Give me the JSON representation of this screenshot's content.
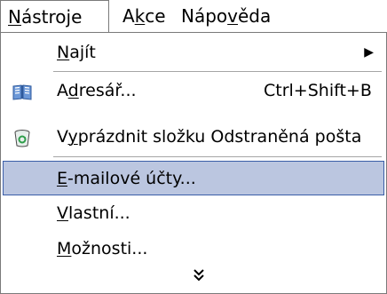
{
  "menubar": {
    "items": [
      {
        "pre": "",
        "hot": "N",
        "post": "ástroje"
      },
      {
        "pre": "A",
        "hot": "k",
        "post": "ce"
      },
      {
        "pre": "Nápo",
        "hot": "v",
        "post": "ěda"
      }
    ]
  },
  "menu": {
    "items": [
      {
        "pre": "",
        "hot": "N",
        "post": "ajít",
        "shortcut": "",
        "icon": "",
        "submenu": true
      },
      {
        "pre": "A",
        "hot": "d",
        "post": "resář...",
        "shortcut": "Ctrl+Shift+B",
        "icon": "address-book-icon",
        "submenu": false
      },
      {
        "pre": "V",
        "hot": "y",
        "post": "prázdnit složku Odstraněná pošta",
        "shortcut": "",
        "icon": "recycle-bin-icon",
        "submenu": false
      },
      {
        "pre": "",
        "hot": "E",
        "post": "-mailové účty...",
        "shortcut": "",
        "icon": "",
        "submenu": false
      },
      {
        "pre": "",
        "hot": "V",
        "post": "lastní...",
        "shortcut": "",
        "icon": "",
        "submenu": false
      },
      {
        "pre": "",
        "hot": "M",
        "post": "ožnosti...",
        "shortcut": "",
        "icon": "",
        "submenu": false
      }
    ],
    "expand_icon": "double-chevron-down-icon",
    "highlight_color": "#bbc6e0"
  }
}
